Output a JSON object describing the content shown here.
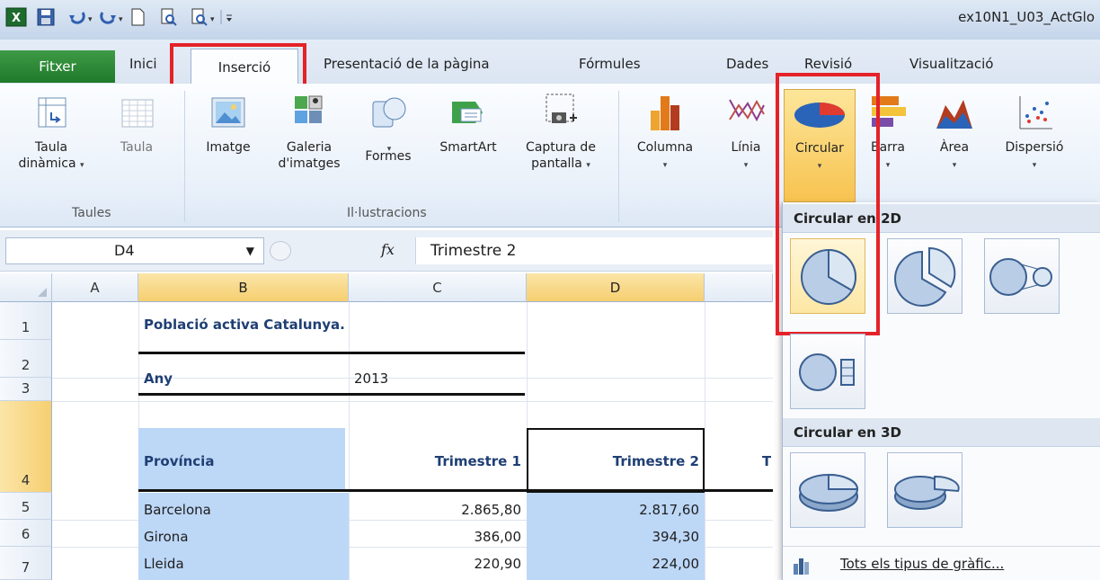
{
  "window": {
    "title": "ex10N1_U03_ActGlo"
  },
  "tabs": [
    {
      "id": "file",
      "label": "Fitxer"
    },
    {
      "id": "home",
      "label": "Inici"
    },
    {
      "id": "insert",
      "label": "Inserció"
    },
    {
      "id": "page_layout",
      "label": "Presentació de la pàgina"
    },
    {
      "id": "formulas",
      "label": "Fórmules"
    },
    {
      "id": "data",
      "label": "Dades"
    },
    {
      "id": "review",
      "label": "Revisió"
    },
    {
      "id": "view",
      "label": "Visualització"
    }
  ],
  "ribbon": {
    "taules": {
      "group_label": "Taules",
      "pivot_line1": "Taula",
      "pivot_line2": "dinàmica",
      "table_label": "Taula"
    },
    "illustrations": {
      "group_label": "Il·lustracions",
      "picture": "Imatge",
      "clipart_line1": "Galeria",
      "clipart_line2": "d'imatges",
      "shapes": "Formes",
      "smartart": "SmartArt",
      "screenshot_line1": "Captura de",
      "screenshot_line2": "pantalla"
    },
    "charts": {
      "column": "Columna",
      "line": "Línia",
      "pie": "Circular",
      "bar": "Barra",
      "area": "Àrea",
      "scatter": "Dispersió"
    }
  },
  "formula_bar": {
    "name_box": "D4",
    "fx": "fx",
    "content": "Trimestre 2"
  },
  "grid": {
    "columns": [
      "A",
      "B",
      "C",
      "D"
    ],
    "rows": [
      "1",
      "2",
      "3",
      "4",
      "5",
      "6",
      "7"
    ],
    "b1": "Població activa Catalunya.",
    "b2": "Any",
    "c2": "2013",
    "header": {
      "province": "Província",
      "q1": "Trimestre 1",
      "q2": "Trimestre 2",
      "q3_partial": "T"
    },
    "data_rows": [
      {
        "province": "Barcelona",
        "q1": "2.865,80",
        "q2": "2.817,60"
      },
      {
        "province": "Girona",
        "q1": "386,00",
        "q2": "394,30"
      },
      {
        "province": "Lleida",
        "q1": "220,90",
        "q2": "224,00"
      }
    ]
  },
  "dropdown": {
    "section_2d": "Circular en 2D",
    "section_3d": "Circular en 3D",
    "all_types": "Tots els tipus de gràfic..."
  },
  "colors": {
    "accent_red": "#e52229",
    "file_tab": "#2e8b3a",
    "selection": "#fbd87a",
    "cell_fill": "#bdd7f7"
  }
}
